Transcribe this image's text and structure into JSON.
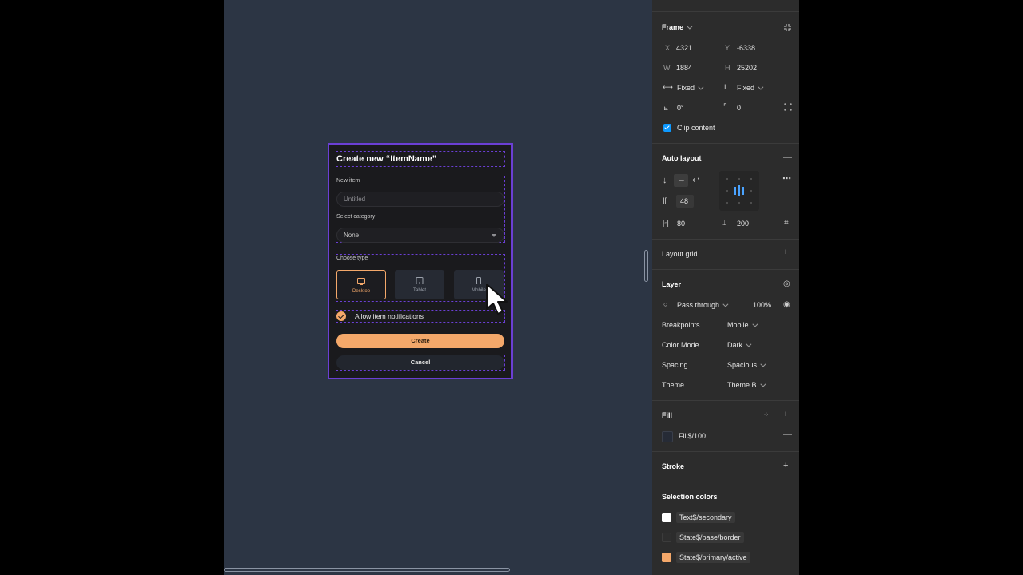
{
  "colors": {
    "canvas": "#2c3544",
    "frame_stroke": "#6b3fd4",
    "primary": "#f4a86a",
    "panel_bg": "#2c2c2c",
    "checkbox": "#0d99ff"
  },
  "dialog": {
    "title": "Create new “ItemName”",
    "new_item_label": "New item",
    "new_item_placeholder": "Untitled",
    "category_label": "Select category",
    "category_value": "None",
    "choose_type_label": "Choose type",
    "types": [
      {
        "label": "Desktop",
        "icon": "desktop-icon",
        "selected": true
      },
      {
        "label": "Tablet",
        "icon": "tablet-icon",
        "selected": false
      },
      {
        "label": "Mobile",
        "icon": "mobile-icon",
        "selected": false
      }
    ],
    "notifications_label": "Allow item notifications",
    "notifications_checked": true,
    "create_label": "Create",
    "cancel_label": "Cancel"
  },
  "panel": {
    "frame": {
      "heading": "Frame",
      "x_label": "X",
      "x_value": "4321",
      "y_label": "Y",
      "y_value": "-6338",
      "w_label": "W",
      "w_value": "1884",
      "h_label": "H",
      "h_value": "25202",
      "h_sizing": "Fixed",
      "v_sizing": "Fixed",
      "rotation": "0°",
      "radius": "0",
      "clip_content_label": "Clip content",
      "clip_content": true
    },
    "auto_layout": {
      "heading": "Auto layout",
      "gap": "48",
      "padding_h": "80",
      "padding_v": "200"
    },
    "layout_grid": {
      "heading": "Layout grid"
    },
    "layer": {
      "heading": "Layer",
      "blend": "Pass through",
      "opacity": "100%",
      "rows": [
        {
          "label": "Breakpoints",
          "value": "Mobile"
        },
        {
          "label": "Color Mode",
          "value": "Dark"
        },
        {
          "label": "Spacing",
          "value": "Spacious"
        },
        {
          "label": "Theme",
          "value": "Theme B"
        }
      ]
    },
    "fill": {
      "heading": "Fill",
      "value": "Fill$/100",
      "swatch": "#262b36"
    },
    "stroke": {
      "heading": "Stroke"
    },
    "selection_colors": {
      "heading": "Selection colors",
      "items": [
        {
          "name": "Text$/secondary",
          "color": "#ffffff"
        },
        {
          "name": "State$/base/border",
          "color": "#2e2e2e"
        },
        {
          "name": "State$/primary/active",
          "color": "#f4a86a"
        }
      ]
    }
  }
}
